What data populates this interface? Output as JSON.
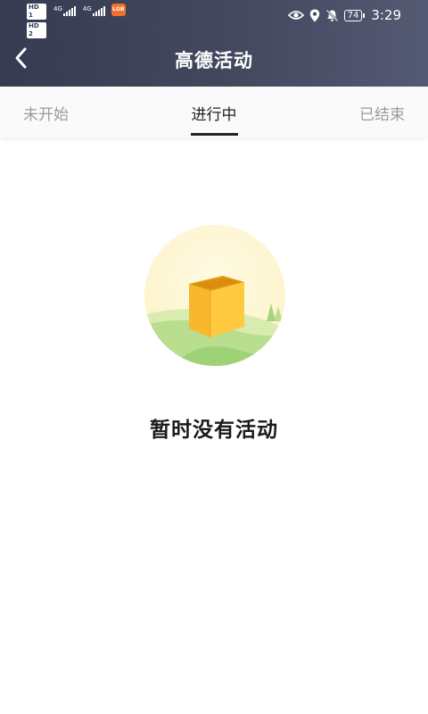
{
  "status_bar": {
    "sim1_badge": "HD 1",
    "sim2_badge": "HD 2",
    "network1": "4G",
    "network2": "4G",
    "app_badge": "LGB",
    "battery": "74",
    "time": "3:29",
    "icons": [
      "eye-icon",
      "location-icon",
      "bell-off-icon"
    ]
  },
  "header": {
    "title": "高德活动",
    "back_icon": "chevron-left-icon"
  },
  "tabs": [
    {
      "label": "未开始",
      "active": false
    },
    {
      "label": "进行中",
      "active": true
    },
    {
      "label": "已结束",
      "active": false
    }
  ],
  "empty_state": {
    "icon": "empty-box-icon",
    "message": "暂时没有活动"
  },
  "colors": {
    "header_bg": "#3f445b",
    "tab_active": "#222222",
    "tab_inactive": "#9b9b9b",
    "illustration_box": "#f8b72c"
  }
}
